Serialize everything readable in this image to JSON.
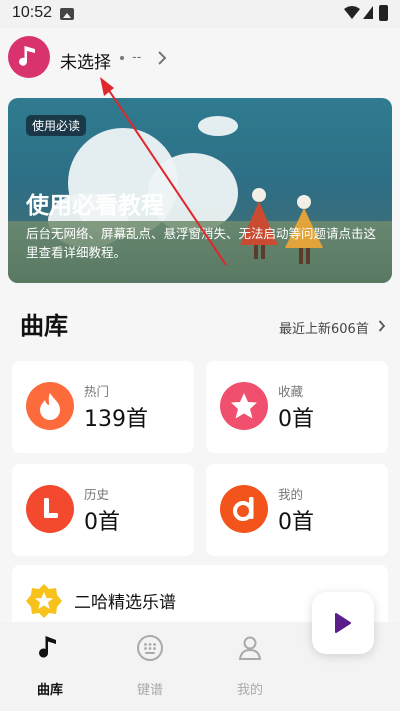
{
  "status_bar": {
    "time": "10:52"
  },
  "header": {
    "song_title": "未选择",
    "song_subtitle": "--"
  },
  "banner": {
    "tag": "使用必读",
    "title": "使用必看教程",
    "description": "后台无网络、屏幕乱点、悬浮窗消失、无法启动等问题请点击这里查看详细教程。"
  },
  "library": {
    "title": "曲库",
    "recent_link": "最近上新606首",
    "cards": [
      {
        "label": "热门",
        "count": "139首",
        "color": "#fd6b3c"
      },
      {
        "label": "收藏",
        "count": "0首",
        "color": "#f0506e"
      },
      {
        "label": "历史",
        "count": "0首",
        "color": "#f2492f"
      },
      {
        "label": "我的",
        "count": "0首",
        "color": "#f2541b"
      }
    ],
    "featured": {
      "label": "二哈精选乐谱",
      "badge_color": "#f6c21b"
    }
  },
  "bottom_nav": {
    "items": [
      {
        "label": "曲库",
        "active": true
      },
      {
        "label": "键谱",
        "active": false
      },
      {
        "label": "我的",
        "active": false
      }
    ]
  },
  "colors": {
    "avatar": "#d8336f",
    "accent_play": "#5a1d8a",
    "annotation": "#e0262a"
  }
}
